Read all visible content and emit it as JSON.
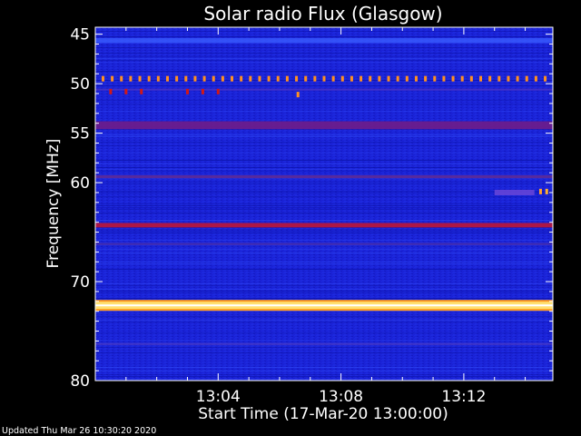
{
  "chart_data": {
    "type": "heatmap",
    "title": "Solar radio Flux (Glasgow)",
    "xlabel": "Start Time (17-Mar-20 13:00:00)",
    "ylabel": "Frequency [MHz]",
    "x_unit": "minutes after 13:00",
    "xlim": [
      0,
      14.9
    ],
    "ylim": [
      80,
      44.3
    ],
    "x_ticks": [
      {
        "value": 4,
        "label": "13:04"
      },
      {
        "value": 8,
        "label": "13:08"
      },
      {
        "value": 12,
        "label": "13:12"
      }
    ],
    "y_ticks": [
      {
        "value": 45,
        "label": "45"
      },
      {
        "value": 50,
        "label": "50"
      },
      {
        "value": 55,
        "label": "55"
      },
      {
        "value": 60,
        "label": "60"
      },
      {
        "value": 70,
        "label": "70"
      },
      {
        "value": 80,
        "label": "80"
      }
    ],
    "background_color": "#1a22d6",
    "emission_bands": [
      {
        "freq_mhz": 72.4,
        "width_mhz": 0.55,
        "intensity": "max",
        "color": "#ffffff"
      },
      {
        "freq_mhz": 64.3,
        "width_mhz": 0.45,
        "intensity": "high",
        "color": "#b4163e"
      },
      {
        "freq_mhz": 54.2,
        "width_mhz": 0.8,
        "intensity": "medium",
        "color": "#6a1c8c"
      },
      {
        "freq_mhz": 59.4,
        "width_mhz": 0.3,
        "intensity": "medium",
        "color": "#5a2a9a"
      },
      {
        "freq_mhz": 66.2,
        "width_mhz": 0.25,
        "intensity": "low",
        "color": "#4a30b0"
      },
      {
        "freq_mhz": 50.6,
        "width_mhz": 0.2,
        "intensity": "low",
        "color": "#4a30c0"
      },
      {
        "freq_mhz": 76.3,
        "width_mhz": 0.2,
        "intensity": "low",
        "color": "#4b3bc4"
      }
    ],
    "periodic_bursts": [
      {
        "freq_mhz": 49.5,
        "t_start": 0.25,
        "t_end": 14.7,
        "period_min": 0.3,
        "color": "#ff9020"
      },
      {
        "freq_mhz": 50.8,
        "t_start": 0.5,
        "t_end": 4.2,
        "period_min": 0.5,
        "color": "#d01818"
      }
    ],
    "isolated_bursts": [
      {
        "t": 6.6,
        "freq_mhz": 51.1,
        "color": "#ff9020"
      },
      {
        "t": 14.5,
        "freq_mhz": 60.9,
        "color": "#ffa030"
      },
      {
        "t": 14.7,
        "freq_mhz": 60.9,
        "color": "#ffb030"
      }
    ],
    "faint_bursts": [
      {
        "t_start": 13.0,
        "t_end": 14.3,
        "freq_mhz": 61.0,
        "color": "#6a46d8"
      }
    ]
  },
  "footer": {
    "updated": "Updated Thu Mar 26 10:30:20 2020"
  }
}
